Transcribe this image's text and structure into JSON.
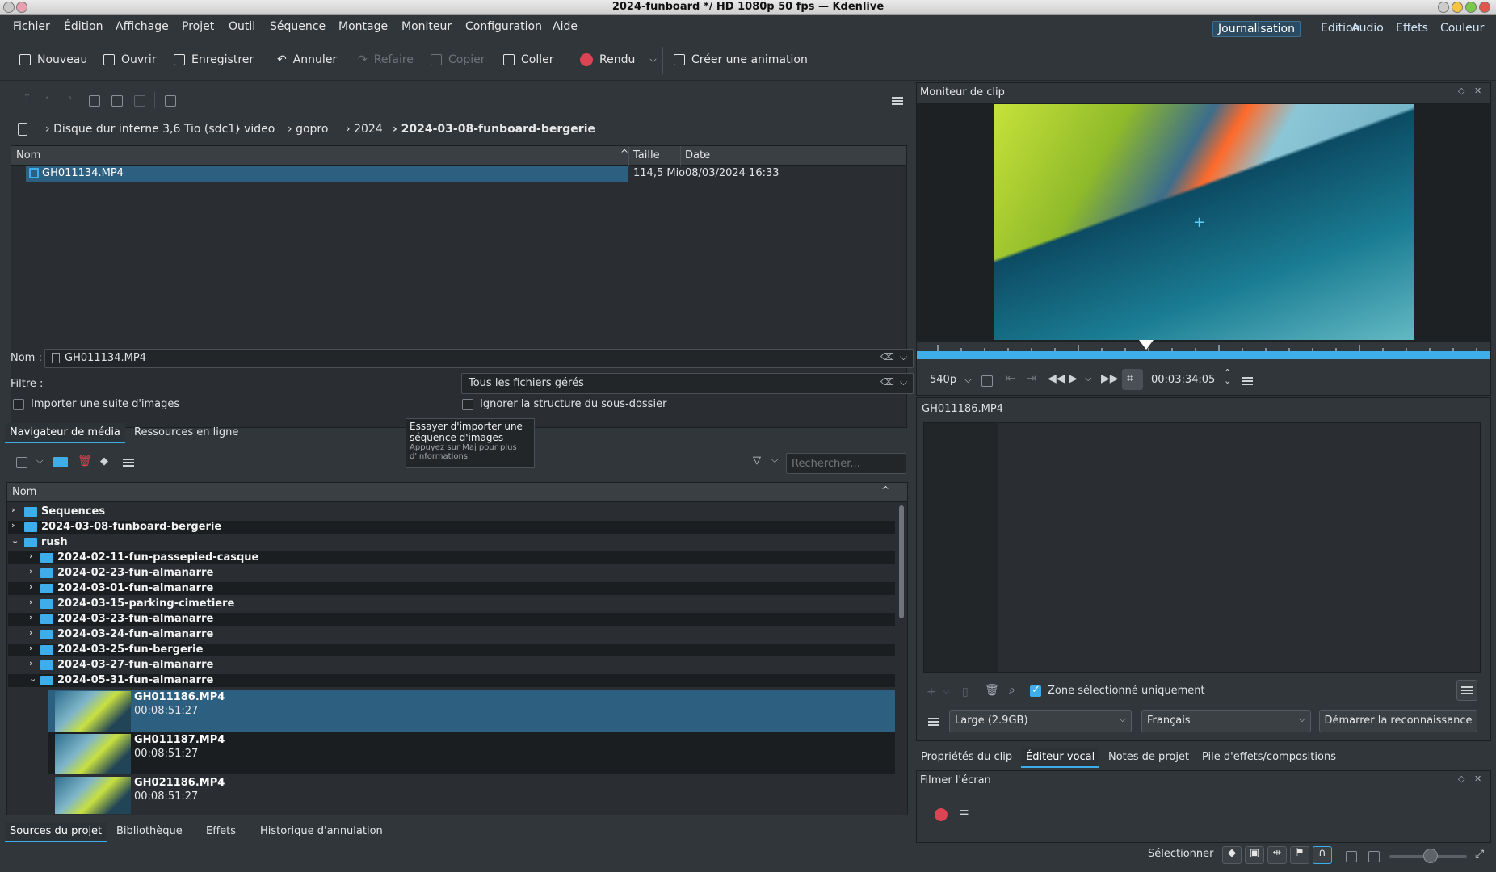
{
  "window": {
    "title": "2024-funboard */ HD 1080p 50 fps — Kdenlive"
  },
  "menu": [
    "Fichier",
    "Édition",
    "Affichage",
    "Projet",
    "Outil",
    "Séquence",
    "Montage",
    "Moniteur",
    "Configuration",
    "Aide"
  ],
  "workspaces": {
    "items": [
      "Journalisation",
      "Edition",
      "Audio",
      "Effets",
      "Couleur"
    ],
    "active": "Journalisation"
  },
  "toolbar": {
    "new": "Nouveau",
    "open": "Ouvrir",
    "save": "Enregistrer",
    "undo": "Annuler",
    "redo": "Refaire",
    "copy": "Copier",
    "paste": "Coller",
    "render": "Rendu",
    "animation": "Créer une animation"
  },
  "file_browser": {
    "breadcrumb": [
      "Disque dur interne 3,6 Tio (sdc1)",
      "video",
      "gopro",
      "2024",
      "2024-03-08-funboard-bergerie"
    ],
    "columns": [
      "Nom",
      "Taille",
      "Date"
    ],
    "rows": [
      {
        "name": "GH011134.MP4",
        "size": "114,5 Mio",
        "date": "08/03/2024 16:33"
      }
    ],
    "name_label": "Nom :",
    "name_value": "GH011134.MP4",
    "filter_label": "Filtre :",
    "filter_value": "Tous les fichiers gérés",
    "import_sequence": "Importer une suite d'images",
    "ignore_subfolder": "Ignorer la structure du sous-dossier"
  },
  "tooltip": {
    "line1": "Essayer d'importer une",
    "line2": "séquence d'images",
    "hint1": "Appuyez sur Maj pour plus",
    "hint2": "d'informations."
  },
  "browser_tabs": [
    "Navigateur de média",
    "Ressources en ligne"
  ],
  "bin": {
    "search_placeholder": "Rechercher...",
    "header": "Nom",
    "folders_top": [
      "Sequences",
      "2024-03-08-funboard-bergerie",
      "rush"
    ],
    "subfolders": [
      "2024-02-11-fun-passepied-casque",
      "2024-02-23-fun-almanarre",
      "2024-03-01-fun-almanarre",
      "2024-03-15-parking-cimetiere",
      "2024-03-23-fun-almanarre",
      "2024-03-24-fun-almanarre",
      "2024-03-25-fun-bergerie",
      "2024-03-27-fun-almanarre",
      "2024-05-31-fun-almanarre"
    ],
    "clips": [
      {
        "name": "GH011186.MP4",
        "duration": "00:08:51:27"
      },
      {
        "name": "GH011187.MP4",
        "duration": "00:08:51:27"
      },
      {
        "name": "GH021186.MP4",
        "duration": "00:08:51:27"
      }
    ]
  },
  "bottom_tabs": [
    "Sources du projet",
    "Bibliothèque",
    "Effets",
    "Historique d'annulation"
  ],
  "clip_monitor": {
    "title": "Moniteur de clip",
    "resolution": "540p",
    "timecode": "00:03:34:05",
    "playhead_fraction": 0.4
  },
  "voice_editor": {
    "clip_name": "GH011186.MP4",
    "selected_zone_only": "Zone sélectionné uniquement",
    "model": "Large (2.9GB)",
    "language": "Français",
    "start": "Démarrer la reconnaissance"
  },
  "right_tabs": [
    "Propriétés du clip",
    "Éditeur vocal",
    "Notes de projet",
    "Pile d'effets/compositions"
  ],
  "screen_grab": {
    "title": "Filmer l'écran"
  },
  "status": {
    "mode": "Sélectionner"
  },
  "colors": {
    "accent": "#3daee9",
    "selection": "#2d5f80",
    "record": "#da4453"
  }
}
